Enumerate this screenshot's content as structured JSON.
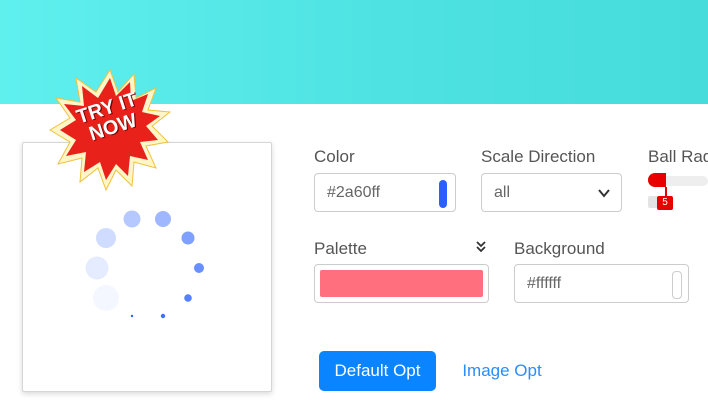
{
  "badge": {
    "line1": "TRY IT",
    "line2": "NOW"
  },
  "form": {
    "color": {
      "label": "Color",
      "value": "#2a60ff",
      "swatch": "#2a60ff"
    },
    "scale_direction": {
      "label": "Scale Direction",
      "value": "all"
    },
    "ball_radius": {
      "label": "Ball Rad",
      "value": "5",
      "accent": "#e80000"
    },
    "palette": {
      "label": "Palette",
      "swatch": "#ff6f7e"
    },
    "background": {
      "label": "Background",
      "value": "#ffffff"
    }
  },
  "buttons": {
    "default_opt": "Default Opt",
    "image_opt": "Image Opt"
  },
  "colors": {
    "hero": "#4ee2e2",
    "primary": "#0a84ff",
    "loader": "#2a60ff"
  }
}
